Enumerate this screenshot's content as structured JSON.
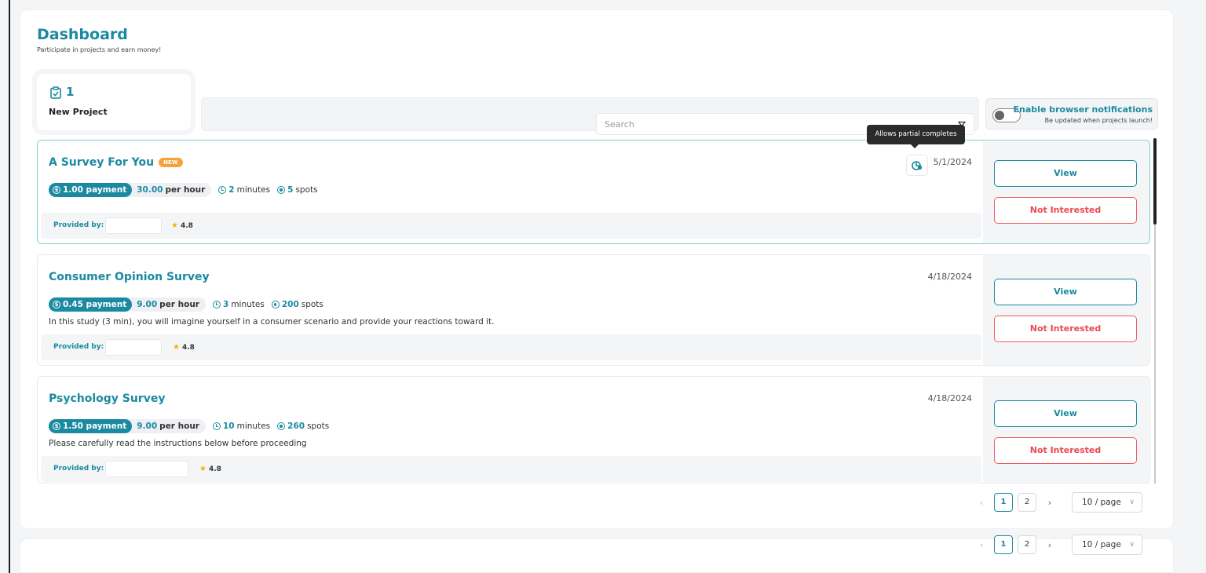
{
  "header": {
    "title": "Dashboard",
    "subtitle": "Participate in projects and earn money!"
  },
  "stat": {
    "value": "1",
    "label": "New Project",
    "icon": "clipboard-check-icon"
  },
  "search": {
    "placeholder": "Search"
  },
  "notifications": {
    "title": "Enable browser notifications",
    "subtitle": "Be updated when projects launch!",
    "enabled": false
  },
  "tooltip": {
    "text": "Allows partial completes"
  },
  "projects": [
    {
      "title": "A Survey For You",
      "badge": "NEW",
      "payment": "1.00 payment",
      "rate": "30.00",
      "rate_unit": "per hour",
      "duration": "2",
      "duration_unit": "minutes",
      "spots": "5",
      "spots_unit": "spots",
      "description": "",
      "provider_label": "Provided by:",
      "rating": "4.8",
      "date": "5/1/2024",
      "view": "View",
      "not_interested": "Not Interested"
    },
    {
      "title": "Consumer Opinion Survey",
      "payment": "0.45 payment",
      "rate": "9.00",
      "rate_unit": "per hour",
      "duration": "3",
      "duration_unit": "minutes",
      "spots": "200",
      "spots_unit": "spots",
      "description": "In this study (3 min), you will imagine yourself in a consumer scenario and provide your reactions toward it.",
      "provider_label": "Provided by:",
      "rating": "4.8",
      "date": "4/18/2024",
      "view": "View",
      "not_interested": "Not Interested"
    },
    {
      "title": "Psychology Survey",
      "payment": "1.50 payment",
      "rate": "9.00",
      "rate_unit": "per hour",
      "duration": "10",
      "duration_unit": "minutes",
      "spots": "260",
      "spots_unit": "spots",
      "description": "Please carefully read the instructions below before proceeding",
      "provider_label": "Provided by:",
      "rating": "4.8",
      "date": "4/18/2024",
      "view": "View",
      "not_interested": "Not Interested"
    }
  ],
  "pagination": {
    "prev": "‹",
    "next": "›",
    "pages": [
      "1",
      "2"
    ],
    "current": "1",
    "page_size": "10 / page"
  },
  "colors": {
    "accent": "#1b8aa1",
    "danger": "#e84a52",
    "badge": "#f6a23c"
  }
}
